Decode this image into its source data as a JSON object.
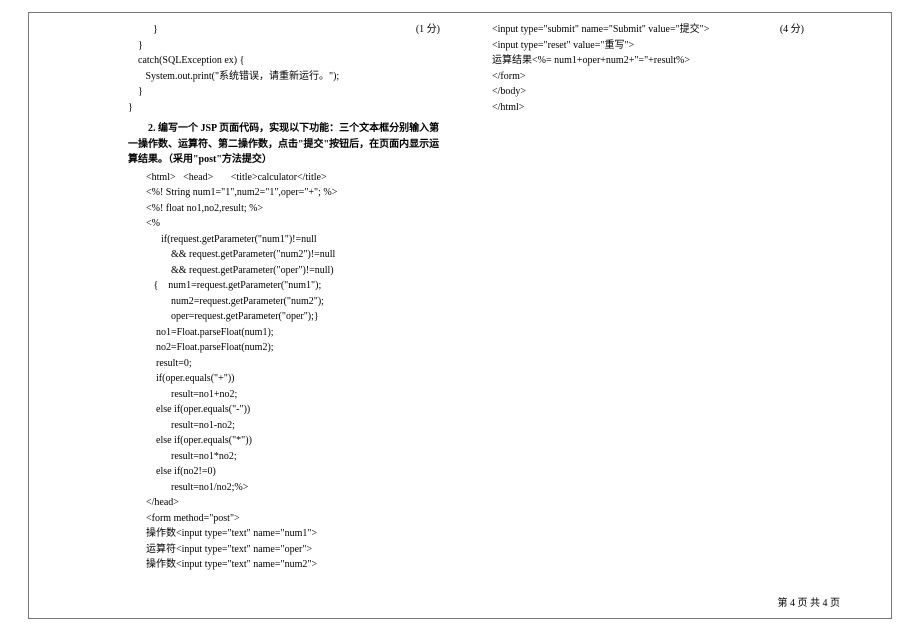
{
  "left": {
    "block1": [
      "          }",
      "    }",
      "    catch(SQLException ex) {",
      "       System.out.print(\"系统错误，请重新运行。\");",
      "    }",
      "}"
    ],
    "score1": "(1 分)",
    "question": "2.  编写一个 JSP 页面代码，实现以下功能：三个文本框分别输入第一操作数、运算符、第二操作数，点击\"提交\"按钮后，在页面内显示运算结果。（采用\"post\"方法提交）",
    "block2": [
      "<html>   <head>       <title>calculator</title>",
      "<%! String num1=\"1\",num2=\"1\",oper=\"+\"; %>",
      "<%! float no1,no2,result; %>",
      "<%",
      "      if(request.getParameter(\"num1\")!=null",
      "          && request.getParameter(\"num2\")!=null",
      "          && request.getParameter(\"oper\")!=null)",
      "   {    num1=request.getParameter(\"num1\");",
      "          num2=request.getParameter(\"num2\");",
      "          oper=request.getParameter(\"oper\");}",
      "    no1=Float.parseFloat(num1);",
      "    no2=Float.parseFloat(num2);",
      "    result=0;",
      "    if(oper.equals(\"+\"))",
      "          result=no1+no2;",
      "    else if(oper.equals(\"-\"))",
      "          result=no1-no2;",
      "    else if(oper.equals(\"*\"))",
      "          result=no1*no2;",
      "    else if(no2!=0)",
      "          result=no1/no2;%>",
      "</head>",
      "<form method=\"post\">",
      "操作数<input type=\"text\" name=\"num1\">",
      "运算符<input type=\"text\" name=\"oper\">",
      "操作数<input type=\"text\" name=\"num2\">"
    ]
  },
  "right": {
    "block1": [
      "<input type=\"submit\" name=\"Submit\" value=\"提交\">",
      "<input type=\"reset\" value=\"重写\">",
      "运算结果<%= num1+oper+num2+\"=\"+result%>",
      "</form>",
      "</body>",
      "</html>"
    ],
    "score1": "(4 分)"
  },
  "footer": "第 4 页 共 4 页"
}
